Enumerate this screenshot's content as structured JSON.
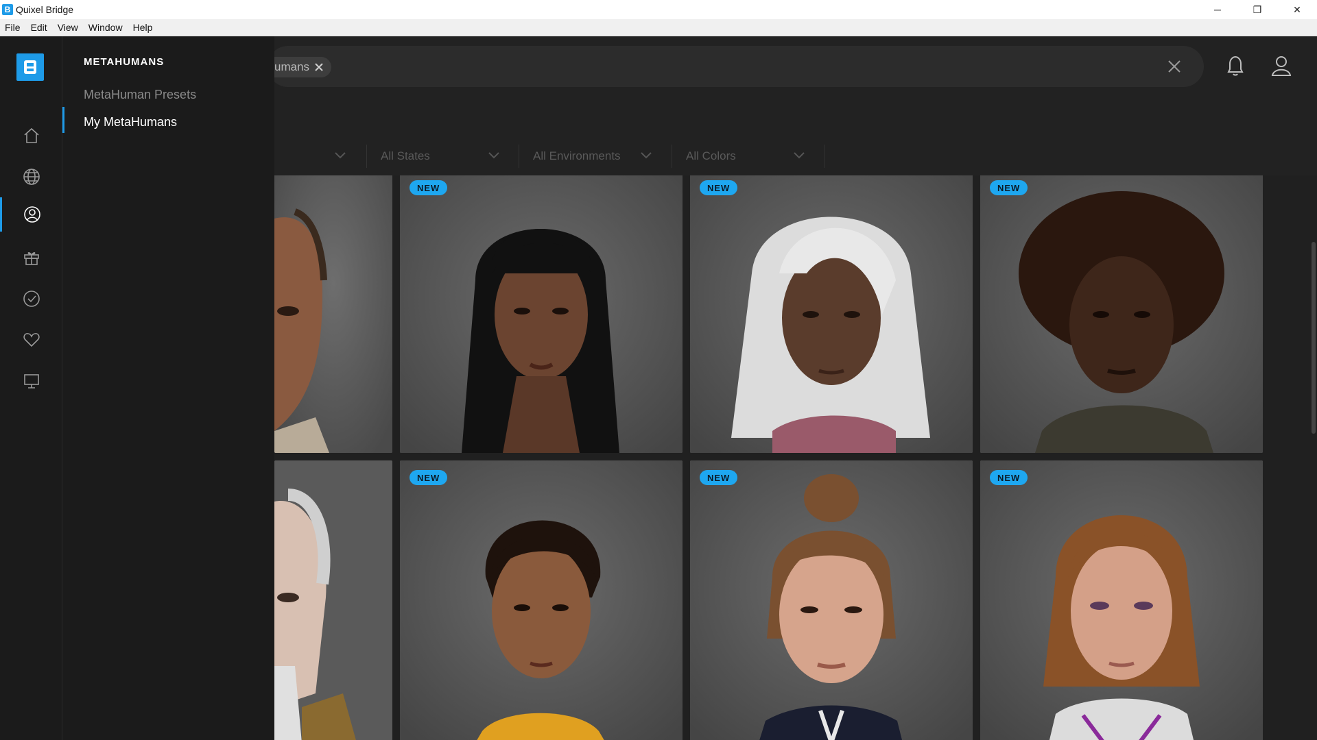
{
  "window": {
    "title": "Quixel Bridge",
    "app_icon": "B",
    "controls": [
      "─",
      "❐",
      "✕"
    ]
  },
  "menu": [
    "File",
    "Edit",
    "View",
    "Window",
    "Help"
  ],
  "rail": {
    "items": [
      "home-icon",
      "globe-icon",
      "user-circle-icon",
      "gift-icon",
      "check-circle-icon",
      "heart-icon",
      "monitor-icon"
    ],
    "active": "user-circle-icon"
  },
  "category_panel": {
    "heading": "METAHUMANS",
    "items": [
      "MetaHuman Presets",
      "My MetaHumans"
    ],
    "active": "My MetaHumans"
  },
  "search": {
    "chip_label": "umans",
    "clear_icon": "close-icon"
  },
  "filters": [
    "All States",
    "All Environments",
    "All Colors"
  ],
  "badge_text": "NEW",
  "colors": {
    "accent": "#1e9be8",
    "badge": "#1ea7f0",
    "background": "#202020",
    "panel": "#1b1b1b"
  }
}
